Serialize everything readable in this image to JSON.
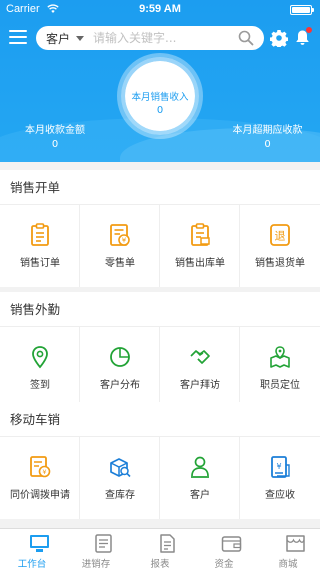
{
  "status_bar": {
    "carrier": "Carrier",
    "time": "9:59 AM"
  },
  "search": {
    "category": "客户",
    "placeholder": "请输入关键字..."
  },
  "summary": {
    "center_label": "本月销售收入",
    "center_value": "0",
    "left_label": "本月收款金额",
    "left_value": "0",
    "right_label": "本月超期应收款",
    "right_value": "0"
  },
  "sections": [
    {
      "title": "销售开单",
      "items": [
        {
          "label": "销售订单",
          "icon": "sales-order-icon"
        },
        {
          "label": "零售单",
          "icon": "retail-order-icon"
        },
        {
          "label": "销售出库单",
          "icon": "sales-outbound-icon"
        },
        {
          "label": "销售退货单",
          "icon": "sales-return-icon"
        }
      ]
    },
    {
      "title": "销售外勤",
      "items": [
        {
          "label": "签到",
          "icon": "check-in-icon"
        },
        {
          "label": "客户分布",
          "icon": "customer-distribution-icon"
        },
        {
          "label": "客户拜访",
          "icon": "customer-visit-icon"
        },
        {
          "label": "职员定位",
          "icon": "staff-location-icon"
        }
      ]
    },
    {
      "title": "移动车销",
      "items": [
        {
          "label": "同价调拨申请",
          "icon": "transfer-request-icon"
        },
        {
          "label": "查库存",
          "icon": "inventory-icon"
        },
        {
          "label": "客户",
          "icon": "customer-icon"
        },
        {
          "label": "查应收",
          "icon": "receivables-icon"
        }
      ]
    }
  ],
  "tabs": [
    {
      "label": "工作台",
      "icon": "workbench-icon",
      "active": true
    },
    {
      "label": "进销存",
      "icon": "inventory-flow-icon",
      "active": false
    },
    {
      "label": "报表",
      "icon": "report-icon",
      "active": false
    },
    {
      "label": "资金",
      "icon": "wallet-icon",
      "active": false
    },
    {
      "label": "商城",
      "icon": "store-icon",
      "active": false
    }
  ],
  "colors": {
    "primary": "#1c9df0",
    "orange": "#f29b12",
    "green": "#22a336",
    "blue": "#1c7fd8",
    "text": "#333333"
  }
}
